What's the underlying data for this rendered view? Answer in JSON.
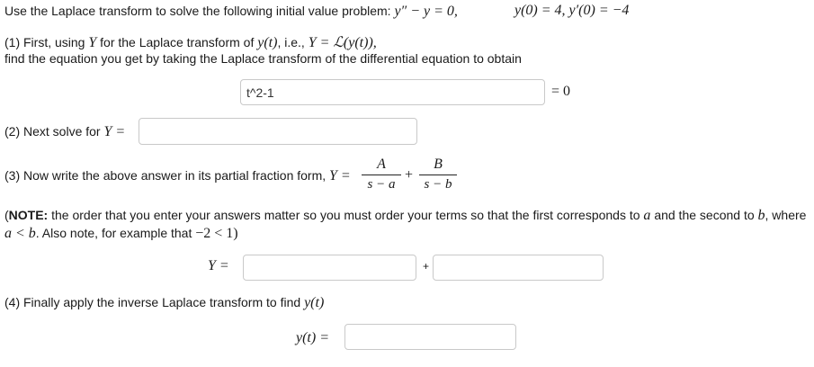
{
  "problem": {
    "intro": "Use the Laplace transform to solve the following initial value problem:",
    "equation": "y″ − y = 0,",
    "initial_conditions": "y(0) = 4,  y′(0) = −4"
  },
  "step1": {
    "text_a": "(1) First, using",
    "var_y": "Y",
    "text_b": "for the Laplace transform of",
    "yt": "y(t)",
    "text_c": ", i.e.,",
    "eq": "Y = ℒ(y(t)),",
    "line2": "find the equation you get by taking the Laplace transform of the differential equation to obtain",
    "input_value": "t^2-1",
    "equals_zero": "= 0"
  },
  "step2": {
    "text": "(2) Next solve for",
    "eq": "Y =",
    "input_value": ""
  },
  "step3": {
    "text": "(3) Now write the above answer in its partial fraction form,",
    "eq": "Y =",
    "frac1_num": "A",
    "frac1_den": "s − a",
    "plus": "+",
    "frac2_num": "B",
    "frac2_den": "s − b"
  },
  "note": {
    "open_paren": "(",
    "bold": "NOTE:",
    "line1": "the order that you enter your answers matter so you must order your terms so that the first corresponds to",
    "var_a": "a",
    "and_text": "and the second to",
    "var_b": "b",
    "where_text": ", where",
    "cond": "a < b",
    "line2_text": ". Also note, for example that",
    "example": "−2 < 1)"
  },
  "answer_row": {
    "eq": "Y =",
    "input1_value": "",
    "plus": "+",
    "input2_value": ""
  },
  "step4": {
    "text": "(4) Finally apply the inverse Laplace transform to find",
    "yt": "y(t)",
    "eq": "y(t) =",
    "input_value": ""
  }
}
